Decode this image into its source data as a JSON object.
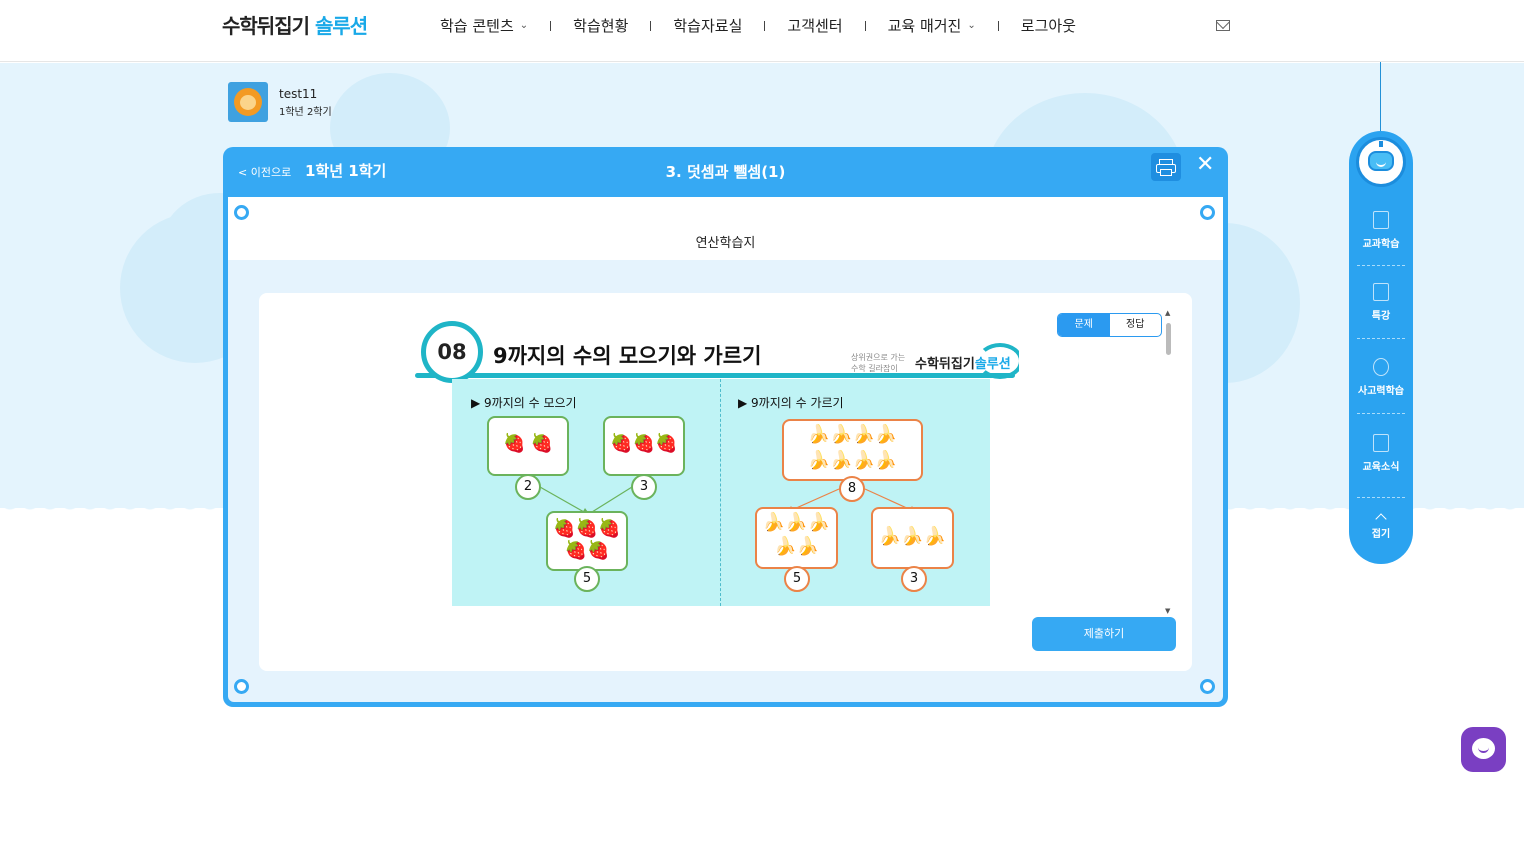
{
  "header": {
    "logo_part1": "수학뒤집기",
    "logo_part2": "솔루션",
    "nav": [
      "학습 콘텐츠",
      "학습현황",
      "학습자료실",
      "고객센터",
      "교육 매거진",
      "로그아웃"
    ]
  },
  "user": {
    "name": "test11",
    "grade": "1학년 2학기"
  },
  "frame": {
    "back_label": "< 이전으로",
    "semester_title": "1학년 1학기",
    "unit_title": "3. 덧셈과 뺄셈(1)",
    "section_title": "연산학습지"
  },
  "toggle": {
    "active": "문제",
    "inactive": "정답"
  },
  "worksheet": {
    "number": "08",
    "title": "9까지의 수의 모으기와 가르기",
    "brand_sub_1": "상위권으로 가는",
    "brand_sub_2": "수학 길라잡이",
    "brand_part1": "수학뒤집기",
    "brand_part2": "솔루션",
    "left_heading": "▶ 9까지의 수 모으기",
    "right_heading": "▶ 9까지의 수 가르기",
    "gather": {
      "a": "2",
      "b": "3",
      "sum": "5"
    },
    "split": {
      "total": "8",
      "a": "5",
      "b": "3"
    }
  },
  "submit_label": "제출하기",
  "quick_menu": [
    "교과학습",
    "특강",
    "사고력학습",
    "교육소식",
    "접기"
  ]
}
